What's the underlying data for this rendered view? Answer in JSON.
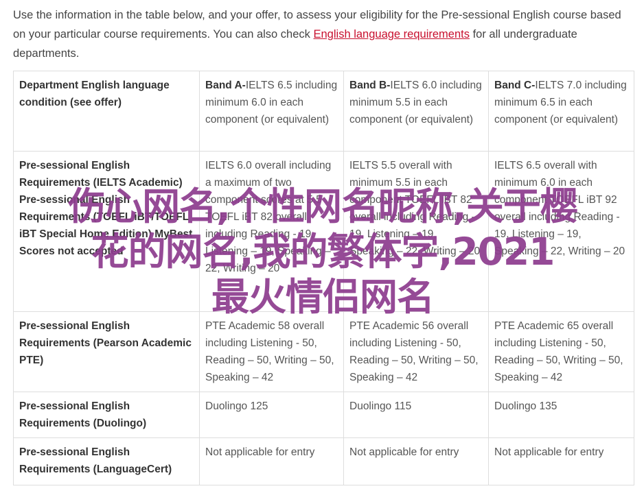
{
  "intro": {
    "before_link": "Use the information in the table below, and your offer, to assess your eligibility for the Pre-sessional English course based on your particular course requirements. You can also check ",
    "link": "English language requirements",
    "after_link": " for all undergraduate departments."
  },
  "table": {
    "header": {
      "label": "Department English language condition (see offer)",
      "bands": [
        {
          "name": "Band A-",
          "text": "IELTS 6.5 including minimum 6.0 in each component (or equivalent)"
        },
        {
          "name": "Band B-",
          "text": "IELTS 6.0 including minimum 5.5 in each component (or equivalent)"
        },
        {
          "name": "Band C-",
          "text": "IELTS 7.0 including minimum 6.5 in each component (or equivalent)"
        }
      ]
    },
    "rows": [
      {
        "label": "Pre-sessional English Requirements (IELTS Academic) Pre-sessional English Requirements (TOEFL iBT/TOEFL iBT Special Home Edition) MyBest Scores not accepted",
        "cells": [
          "IELTS 6.0 overall including a maximum of two component scores at 5.5 TOEFL iBT 82 overall including Reading - 19, Listening – 19, Speaking – 22, Writing – 20",
          "IELTS 5.5 overall with minimum 5.5 in each component TOEFL iBT 82 overall including Reading - 19, Listening – 19, Speaking – 22, Writing – 20",
          "IELTS 6.5 overall with minimum 6.0 in each component TOEFL iBT 92 overall including Reading - 19, Listening – 19, Speaking – 22, Writing – 20"
        ]
      },
      {
        "label": "Pre-sessional English Requirements (Pearson Academic PTE)",
        "cells": [
          "PTE Academic 58 overall including Listening - 50, Reading – 50, Writing – 50, Speaking – 42",
          "PTE Academic 56 overall including Listening - 50, Reading – 50, Writing – 50, Speaking – 42",
          "PTE Academic 65 overall including Listening - 50, Reading – 50, Writing – 50, Speaking – 42"
        ]
      },
      {
        "label": "Pre-sessional English Requirements (Duolingo)",
        "cells": [
          "Duolingo 125",
          "Duolingo 115",
          "Duolingo 135"
        ]
      },
      {
        "label": "Pre-sessional English Requirements (LanguageCert)",
        "cells": [
          "Not applicable for entry",
          "Not applicable for entry",
          "Not applicable for entry"
        ]
      }
    ]
  },
  "overlay": {
    "line1": "伤心网名,个性网名昵称,关于樱",
    "line2": "花的网名,我的繁体字,2021",
    "line3": "最火情侣网名"
  },
  "colors": {
    "link": "#c8102e",
    "overlay_text": "#8e3d8f",
    "border": "#dddddd"
  }
}
